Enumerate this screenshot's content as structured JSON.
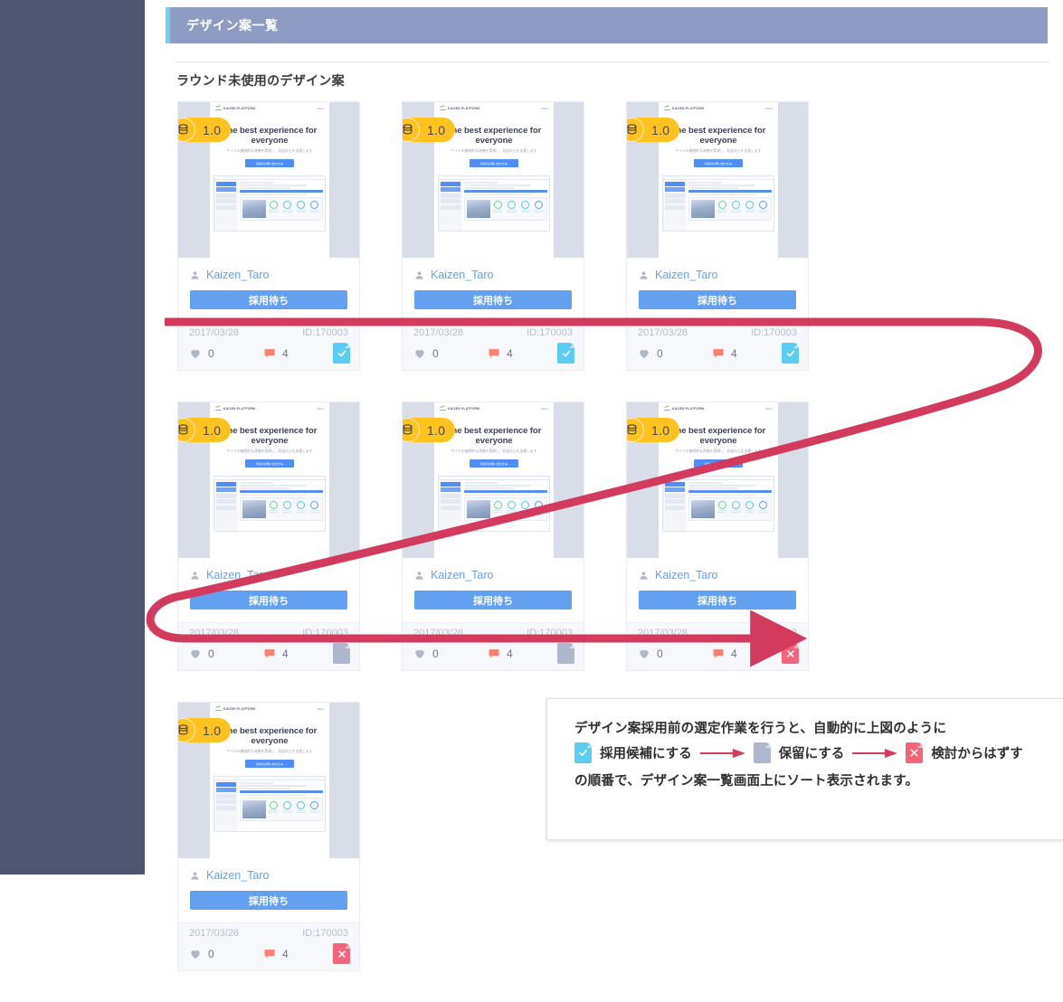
{
  "header": {
    "title": "デザイン案一覧"
  },
  "section": {
    "title": "ラウンド未使用のデザイン案"
  },
  "thumbnail": {
    "logo_text": "KAIZEN PLATFORM",
    "menu_label": "Menu",
    "headline": "The best experience for everyone",
    "subtext": "サイトの継続的な改善を実現し、収益向上を支援します",
    "cta_label": "利用のお問い合わせ ▶"
  },
  "cards": [
    {
      "version": "1.0",
      "user": "Kaizen_Taro",
      "status_label": "採用待ち",
      "date": "2017/03/28",
      "id": "ID:170003",
      "likes": "0",
      "comments": "4",
      "badge": "check"
    },
    {
      "version": "1.0",
      "user": "Kaizen_Taro",
      "status_label": "採用待ち",
      "date": "2017/03/28",
      "id": "ID:170003",
      "likes": "0",
      "comments": "4",
      "badge": "check"
    },
    {
      "version": "1.0",
      "user": "Kaizen_Taro",
      "status_label": "採用待ち",
      "date": "2017/03/28",
      "id": "ID:170003",
      "likes": "0",
      "comments": "4",
      "badge": "check"
    },
    {
      "version": "1.0",
      "user": "Kaizen_Taro",
      "status_label": "採用待ち",
      "date": "2017/03/28",
      "id": "ID:170003",
      "likes": "0",
      "comments": "4",
      "badge": "hold"
    },
    {
      "version": "1.0",
      "user": "Kaizen_Taro",
      "status_label": "採用待ち",
      "date": "2017/03/28",
      "id": "ID:170003",
      "likes": "0",
      "comments": "4",
      "badge": "hold"
    },
    {
      "version": "1.0",
      "user": "Kaizen_Taro",
      "status_label": "採用待ち",
      "date": "2017/03/28",
      "id": "ID:170003",
      "likes": "0",
      "comments": "4",
      "badge": "x"
    },
    {
      "version": "1.0",
      "user": "Kaizen_Taro",
      "status_label": "採用待ち",
      "date": "2017/03/28",
      "id": "ID:170003",
      "likes": "0",
      "comments": "4",
      "badge": "x"
    }
  ],
  "caption": {
    "line1": "デザイン案採用前の選定作業を行うと、自動的に上図のように",
    "item1": "採用候補にする",
    "item2": "保留にする",
    "item3": "検討からはずす",
    "line3": "の順番で、デザイン案一覧画面上にソート表示されます。"
  },
  "colors": {
    "sidebar": "#4e5570",
    "header_bar": "#8e9cc4",
    "header_accent": "#6fd0f2",
    "accent_blue": "#63a0f0",
    "badge_yellow": "#ffc21f",
    "badge_check": "#5bcdf5",
    "badge_hold": "#aeb7cd",
    "badge_x": "#f4647a",
    "annotation": "#d23a5e"
  }
}
